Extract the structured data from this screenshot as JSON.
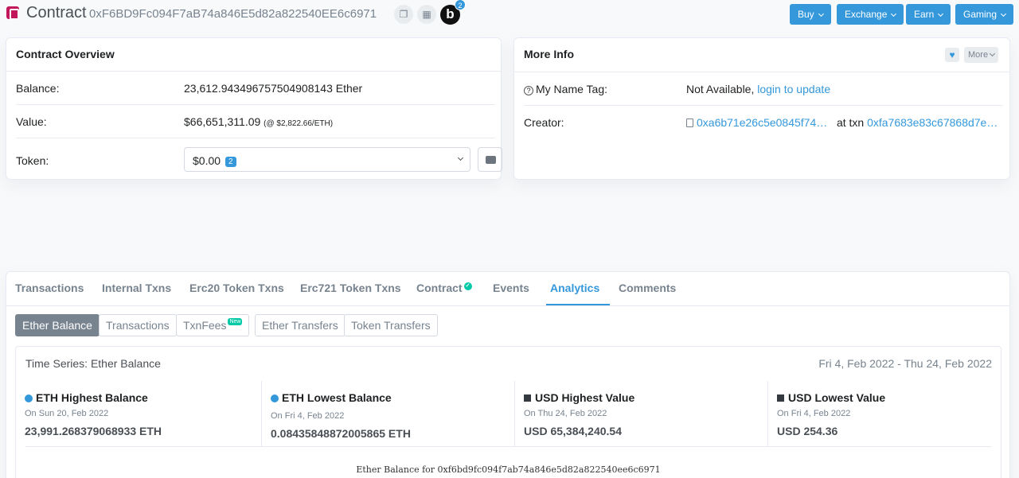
{
  "header": {
    "title": "Contract",
    "address": "0xF6BD9Fc094F7aB74a846E5d82a822540EE6c6971",
    "badge_count": "2",
    "b_label": "b",
    "menus": [
      "Buy",
      "Exchange",
      "Earn",
      "Gaming"
    ]
  },
  "overview": {
    "title": "Contract Overview",
    "balance_label": "Balance:",
    "balance_value": "23,612.943496757504908143 Ether",
    "value_label": "Value:",
    "value_amount": "$66,651,311.09",
    "value_rate": "(@ $2,822.66/ETH)",
    "token_label": "Token:",
    "token_value": "$0.00",
    "token_count": "2"
  },
  "more_info": {
    "title": "More Info",
    "more_label": "More",
    "name_tag_label": "My Name Tag:",
    "name_tag_value": "Not Available,",
    "name_tag_link": "login to update",
    "creator_label": "Creator:",
    "creator_address": "0xa6b71e26c5e0845f74…",
    "creator_at": "at txn",
    "creator_txn": "0xfa7683e83c67868d7e…"
  },
  "tabs": {
    "items": [
      "Transactions",
      "Internal Txns",
      "Erc20 Token Txns",
      "Erc721 Token Txns",
      "Contract",
      "Events",
      "Analytics",
      "Comments"
    ],
    "active": "Analytics"
  },
  "subtabs": {
    "items": [
      "Ether Balance",
      "Transactions",
      "TxnFees",
      "Ether Transfers",
      "Token Transfers"
    ],
    "new_badge": "New"
  },
  "analytics": {
    "title": "Time Series: Ether Balance",
    "range": "Fri 4, Feb 2022 - Thu 24, Feb 2022",
    "stats": [
      {
        "label": "ETH Highest Balance",
        "date": "On Sun 20, Feb 2022",
        "value": "23,991.268379068933 ETH",
        "marker": "dot"
      },
      {
        "label": "ETH Lowest Balance",
        "date": "On Fri 4, Feb 2022",
        "value": "0.08435848872005865 ETH",
        "marker": "dot"
      },
      {
        "label": "USD Highest Value",
        "date": "On Thu 24, Feb 2022",
        "value": "USD 65,384,240.54",
        "marker": "square"
      },
      {
        "label": "USD Lowest Value",
        "date": "On Fri 4, Feb 2022",
        "value": "USD 254.36",
        "marker": "square"
      }
    ],
    "chart_caption": "Ether Balance for 0xf6bd9fc094f7ab74a846e5d82a822540ee6c6971"
  },
  "colors": {
    "accent": "#3498db",
    "success": "#00c9a7",
    "muted": "#77838f"
  }
}
